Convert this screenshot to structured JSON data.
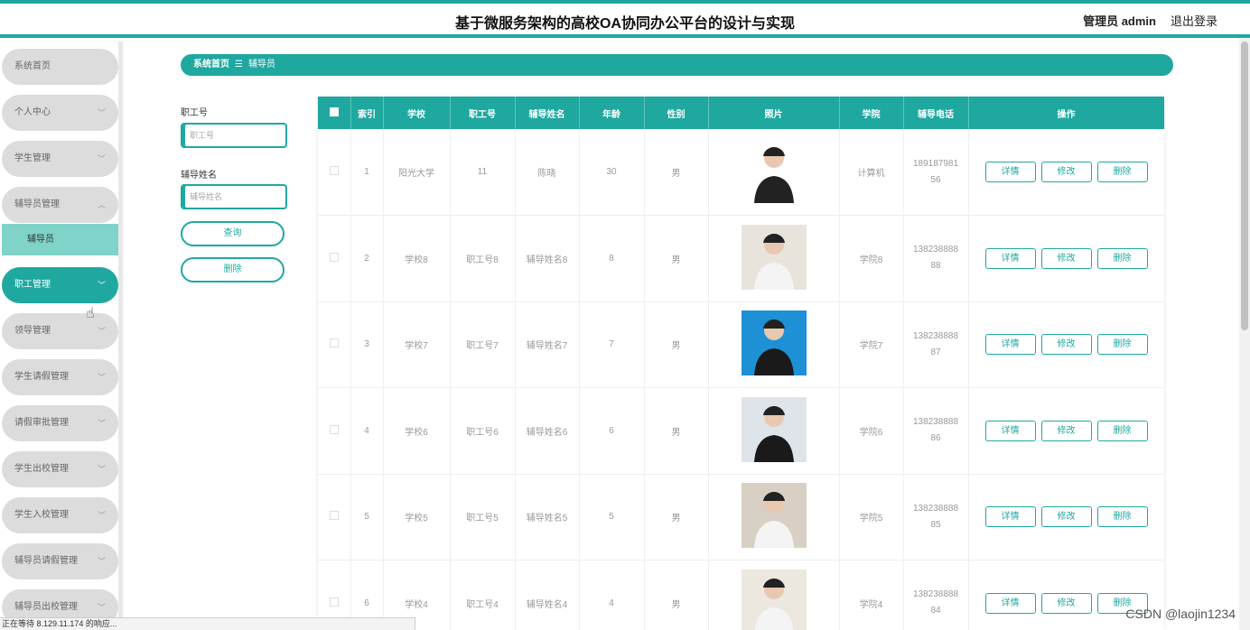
{
  "header": {
    "title": "基于微服务架构的高校OA协同办公平台的设计与实现",
    "admin": "管理员 admin",
    "logout": "退出登录"
  },
  "sidebar": {
    "items": [
      {
        "label": "系统首页",
        "chev": ""
      },
      {
        "label": "个人中心",
        "chev": "﹀"
      },
      {
        "label": "学生管理",
        "chev": "﹀"
      },
      {
        "label": "辅导员管理",
        "chev": "︿"
      },
      {
        "label": "职工管理",
        "chev": "﹀"
      },
      {
        "label": "领导管理",
        "chev": "﹀"
      },
      {
        "label": "学生请假管理",
        "chev": "﹀"
      },
      {
        "label": "请假审批管理",
        "chev": "﹀"
      },
      {
        "label": "学生出校管理",
        "chev": "﹀"
      },
      {
        "label": "学生入校管理",
        "chev": "﹀"
      },
      {
        "label": "辅导员请假管理",
        "chev": "﹀"
      },
      {
        "label": "辅导员出校管理",
        "chev": "﹀"
      }
    ],
    "sub_item": "辅导员"
  },
  "breadcrumb": {
    "home": "系统首页",
    "sep": "☰",
    "current": "辅导员"
  },
  "search": {
    "label1": "职工号",
    "placeholder1": "职工号",
    "label2": "辅导姓名",
    "placeholder2": "辅导姓名",
    "query_btn": "查询",
    "delete_btn": "删除"
  },
  "table": {
    "headers": [
      "索引",
      "学校",
      "职工号",
      "辅导姓名",
      "年龄",
      "性别",
      "照片",
      "学院",
      "辅导电话",
      "操作"
    ],
    "rows": [
      {
        "idx": "1",
        "school": "阳光大学",
        "no": "11",
        "name": "陈晓",
        "age": "30",
        "sex": "男",
        "college": "计算机",
        "phone": "18918798156"
      },
      {
        "idx": "2",
        "school": "学校8",
        "no": "职工号8",
        "name": "辅导姓名8",
        "age": "8",
        "sex": "男",
        "college": "学院8",
        "phone": "13823888888"
      },
      {
        "idx": "3",
        "school": "学校7",
        "no": "职工号7",
        "name": "辅导姓名7",
        "age": "7",
        "sex": "男",
        "college": "学院7",
        "phone": "13823888887"
      },
      {
        "idx": "4",
        "school": "学校6",
        "no": "职工号6",
        "name": "辅导姓名6",
        "age": "6",
        "sex": "男",
        "college": "学院6",
        "phone": "13823888886"
      },
      {
        "idx": "5",
        "school": "学校5",
        "no": "职工号5",
        "name": "辅导姓名5",
        "age": "5",
        "sex": "男",
        "college": "学院5",
        "phone": "13823888885"
      },
      {
        "idx": "6",
        "school": "学校4",
        "no": "职工号4",
        "name": "辅导姓名4",
        "age": "4",
        "sex": "男",
        "college": "学院4",
        "phone": "13823888884"
      }
    ],
    "actions": {
      "detail": "详情",
      "edit": "修改",
      "delete": "删除"
    }
  },
  "statusbar": "正在等待 8.129.11.174 的响应...",
  "watermark": "CSDN @laojin1234",
  "colors": {
    "accent": "#1fa8a0",
    "sub_active": "#7fd3c8"
  }
}
